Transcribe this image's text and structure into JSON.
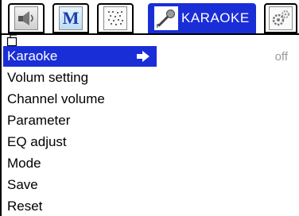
{
  "tabs": [
    {
      "name": "tab-audio",
      "icon": "speaker-icon"
    },
    {
      "name": "tab-mpeg",
      "icon": "m-logo-icon",
      "glyph": "M"
    },
    {
      "name": "tab-subtitle",
      "icon": "pattern-icon"
    },
    {
      "name": "tab-karaoke",
      "icon": "microphone-icon",
      "label": "KARAOKE",
      "active": true
    },
    {
      "name": "tab-settings",
      "icon": "gears-icon"
    }
  ],
  "menu": {
    "items": [
      "Karaoke",
      "Volum setting",
      "Channel volume",
      "Parameter",
      "EQ adjust",
      "Mode",
      "Save",
      "Reset"
    ],
    "selected_index": 0,
    "selected_value": "off"
  },
  "colors": {
    "accent": "#1a2ed8",
    "value_text": "#9a9a9a"
  }
}
